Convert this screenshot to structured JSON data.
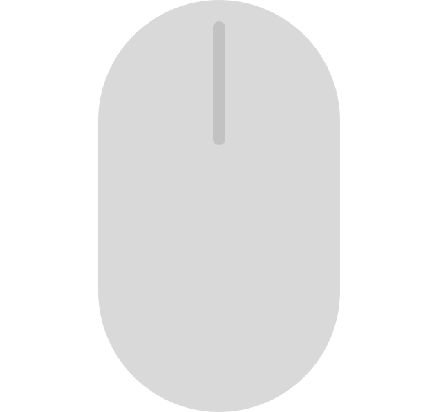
{
  "scene": {
    "icon": "computer-mouse-icon",
    "colors": {
      "background": "#ffffff",
      "mouse_body": "#d9d9d9",
      "scroll_wheel": "#c2c2c2"
    }
  }
}
